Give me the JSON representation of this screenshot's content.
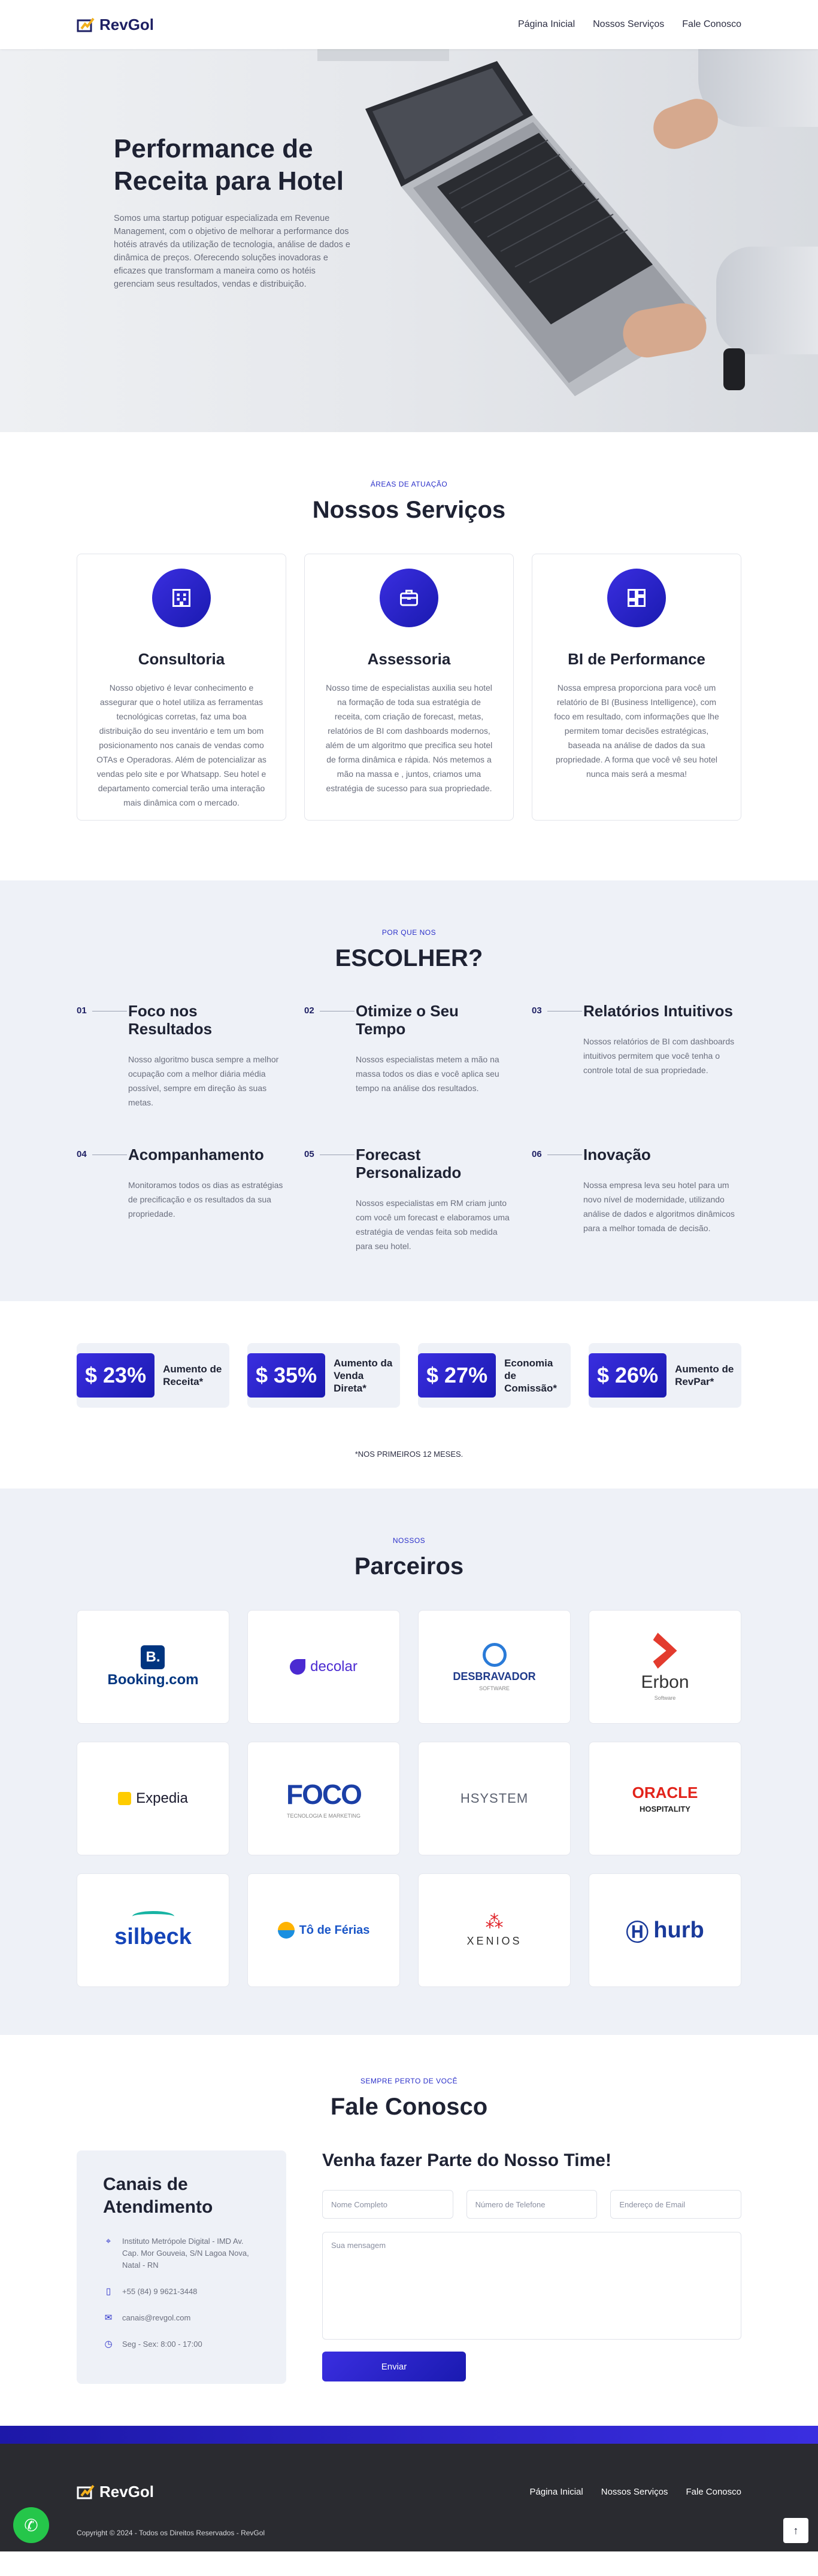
{
  "brand": {
    "name": "RevGol"
  },
  "nav": {
    "items": [
      "Página Inicial",
      "Nossos Serviços",
      "Fale Conosco"
    ]
  },
  "hero": {
    "title": "Performance de Receita para Hotel",
    "text": "Somos uma startup potiguar especializada em Revenue Management, com o objetivo de melhorar a performance dos hotéis através da utilização de tecnologia, análise de dados e dinâmica de preços. Oferecendo soluções inovadoras e eficazes que transformam a maneira como os hotéis gerenciam seus resultados, vendas e distribuição."
  },
  "services": {
    "eyebrow": "ÁREAS DE ATUAÇÃO",
    "title": "Nossos Serviços",
    "items": [
      {
        "icon": "building-icon",
        "title": "Consultoria",
        "text": "Nosso objetivo é levar conhecimento e assegurar que o hotel utiliza as ferramentas tecnológicas corretas, faz uma boa distribuição do seu inventário e tem um bom posicionamento nos canais de vendas como OTAs e Operadoras. Além de potencializar as vendas pelo site e por Whatsapp. Seu hotel e departamento comercial terão uma interação mais dinâmica com o mercado."
      },
      {
        "icon": "briefcase-icon",
        "title": "Assessoria",
        "text": "Nosso time de especialistas auxilia seu hotel na formação de toda sua estratégia de receita, com criação de forecast, metas, relatórios de BI com dashboards modernos, além de um algoritmo que precifica seu hotel de forma dinâmica e rápida. Nós metemos a mão na massa e , juntos, criamos uma estratégia de sucesso para sua propriedade."
      },
      {
        "icon": "dashboard-icon",
        "title": "BI de Performance",
        "text": "Nossa empresa proporciona para você um relatório de BI (Business Intelligence), com foco em resultado, com informações que lhe permitem tomar decisões estratégicas, baseada na análise de dados da sua propriedade. A forma que você vê seu hotel nunca mais será a mesma!"
      }
    ]
  },
  "why": {
    "eyebrow": "POR QUE NOS",
    "title": "ESCOLHER?",
    "items": [
      {
        "num": "01",
        "title": "Foco nos Resultados",
        "text": "Nosso algoritmo busca sempre a melhor ocupação com a melhor diária média possível, sempre em direção às suas metas."
      },
      {
        "num": "02",
        "title": "Otimize o Seu Tempo",
        "text": "Nossos especialistas metem a mão na massa todos os dias e você aplica seu tempo na análise dos resultados."
      },
      {
        "num": "03",
        "title": "Relatórios Intuitivos",
        "text": "Nossos relatórios de BI com dashboards intuitivos permitem que você tenha o controle total de sua propriedade."
      },
      {
        "num": "04",
        "title": "Acompanhamento",
        "text": "Monitoramos todos os dias as estratégias de precificação e os resultados da sua propriedade."
      },
      {
        "num": "05",
        "title": "Forecast Personalizado",
        "text": "Nossos especialistas em RM criam junto com você um forecast e elaboramos uma estratégia de vendas feita sob medida para seu hotel."
      },
      {
        "num": "06",
        "title": "Inovação",
        "text": "Nossa empresa leva seu hotel para um novo nível de modernidade, utilizando análise de dados e algoritmos dinâmicos para a melhor tomada de decisão."
      }
    ]
  },
  "stats": {
    "items": [
      {
        "value": "$ 23%",
        "label": "Aumento de Receita*"
      },
      {
        "value": "$ 35%",
        "label": "Aumento da Venda Direta*"
      },
      {
        "value": "$ 27%",
        "label": "Economia de Comissão*"
      },
      {
        "value": "$ 26%",
        "label": "Aumento de RevPar*"
      }
    ],
    "note": "*NOS PRIMEIROS 12 MESES."
  },
  "partners": {
    "eyebrow": "NOSSOS",
    "title": "Parceiros",
    "items": [
      {
        "name": "Booking.com",
        "color": "#003580"
      },
      {
        "name": "decolar",
        "color": "#4b2ad1"
      },
      {
        "name": "DESBRAVADOR",
        "sub": "SOFTWARE",
        "color": "#1f3a8a"
      },
      {
        "name": "Erbon",
        "sub": "Software",
        "color": "#e33b2e"
      },
      {
        "name": "Expedia",
        "color": "#1a1a2e"
      },
      {
        "name": "FOCO",
        "sub": "TECNOLOGIA E MARKETING",
        "color": "#1b3fa6"
      },
      {
        "name": "HSYSTEM",
        "color": "#5b6170"
      },
      {
        "name": "ORACLE",
        "sub": "HOSPITALITY",
        "color": "#e2231a"
      },
      {
        "name": "silbeck",
        "color": "#1444b8"
      },
      {
        "name": "Tô de Férias",
        "color": "#1a56c8"
      },
      {
        "name": "XENIOS",
        "color": "#333"
      },
      {
        "name": "hurb",
        "color": "#1a3a9a"
      }
    ]
  },
  "contact": {
    "eyebrow": "SEMPRE PERTO DE VOCÊ",
    "title": "Fale Conosco",
    "channels_title": "Canais de Atendimento",
    "address": "Instituto Metrópole Digital - IMD Av. Cap. Mor Gouveia, S/N Lagoa Nova, Natal - RN",
    "phone": "+55 (84) 9 9621-3448",
    "email": "canais@revgol.com",
    "hours": "Seg - Sex: 8:00 - 17:00",
    "form_title": "Venha fazer Parte do Nosso Time!",
    "placeholders": {
      "name": "Nome Completo",
      "phone": "Número de Telefone",
      "email": "Endereço de Email",
      "message": "Sua mensagem"
    },
    "submit": "Enviar"
  },
  "footer": {
    "copyright": "Copyright © 2024 - Todos os Direitos Reservados - RevGol"
  },
  "colors": {
    "accent": "#2a2fc9",
    "dark": "#1e2233",
    "footer": "#2a2b30"
  }
}
